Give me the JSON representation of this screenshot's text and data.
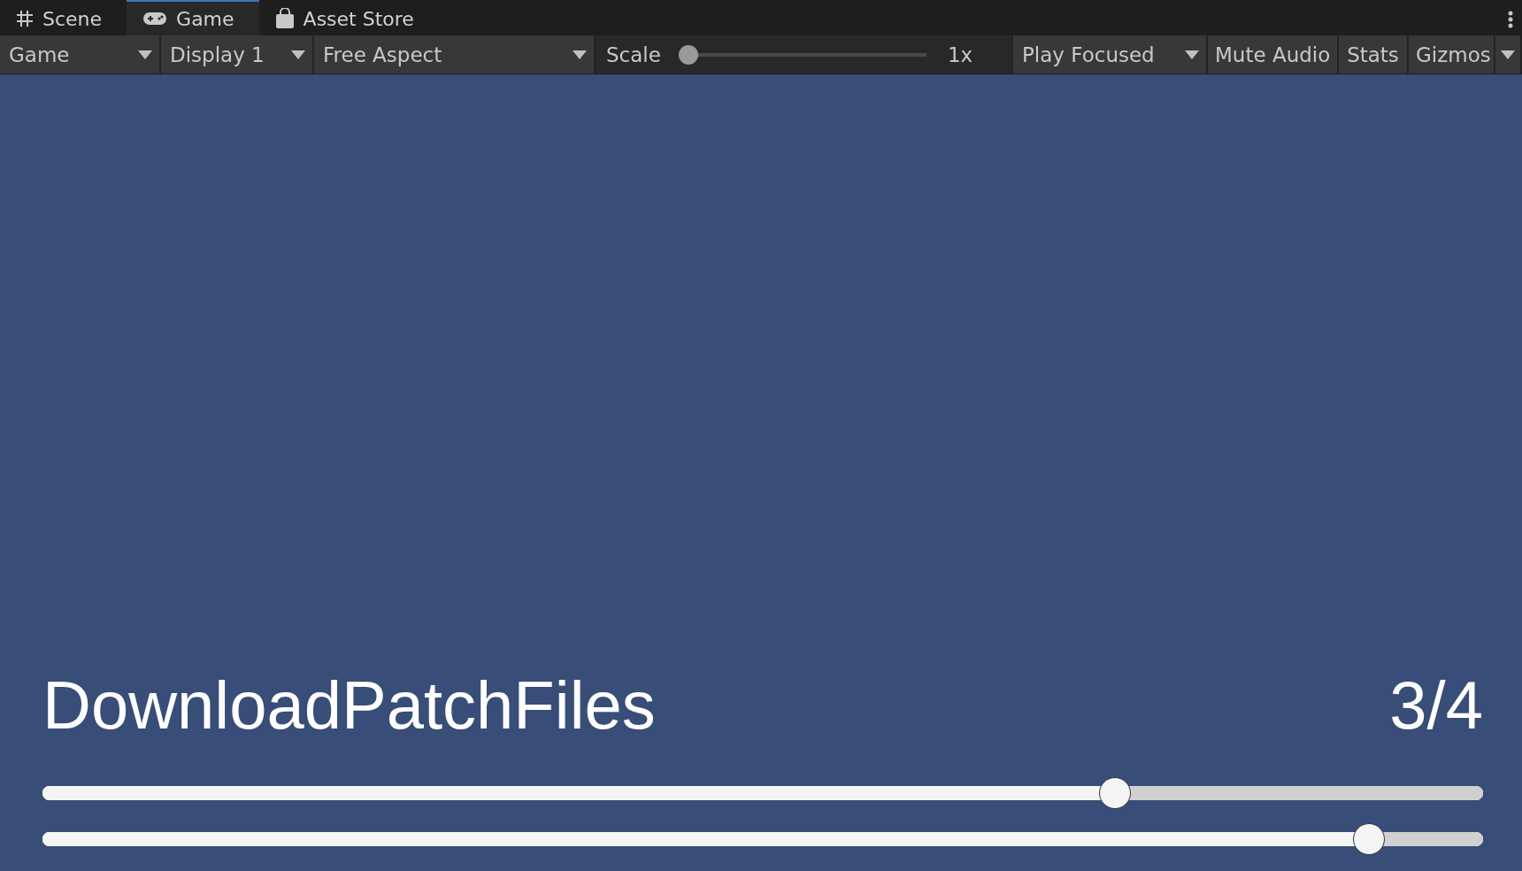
{
  "tabs": [
    {
      "label": "Scene",
      "selected": false
    },
    {
      "label": "Game",
      "selected": true
    },
    {
      "label": "Asset Store",
      "selected": false
    }
  ],
  "toolbar": {
    "view_dropdown": "Game",
    "display_dropdown": "Display 1",
    "aspect_dropdown": "Free Aspect",
    "scale": {
      "label": "Scale",
      "level": 0,
      "reading": "1x"
    },
    "play_mode_dropdown": "Play Focused",
    "buttons": [
      "Mute Audio",
      "Stats",
      "Gizmos"
    ]
  },
  "game_view": {
    "step_name": "DownloadPatchFiles",
    "step_count": "3/4",
    "sliders": [
      {
        "level": 0.75
      },
      {
        "level": 0.93
      }
    ]
  }
}
